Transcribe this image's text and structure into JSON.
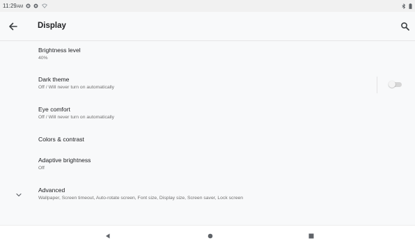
{
  "status_bar": {
    "time": "11:29",
    "ampm": "AM",
    "icons": [
      "gear-icon",
      "shield-icon",
      "wifi-icon",
      "bluetooth-icon",
      "battery-icon"
    ]
  },
  "app_bar": {
    "title": "Display",
    "back_icon": "arrow-back-icon",
    "search_icon": "search-icon"
  },
  "settings": [
    {
      "title": "Brightness level",
      "summary": "40%"
    },
    {
      "title": "Dark theme",
      "summary": "Off / Will never turn on automatically",
      "toggle_on": false
    },
    {
      "title": "Eye comfort",
      "summary": "Off / Will never turn on automatically"
    },
    {
      "title": "Colors & contrast",
      "summary": ""
    },
    {
      "title": "Adaptive brightness",
      "summary": "Off"
    },
    {
      "title": "Advanced",
      "summary": "Wallpaper, Screen timeout, Auto-rotate screen, Font size, Display size, Screen saver, Lock screen",
      "icon": "chevron-down-icon"
    }
  ],
  "nav_bar": {
    "buttons": [
      "back-triangle-icon",
      "home-circle-icon",
      "recents-square-icon"
    ]
  },
  "colors": {
    "status_bar": "#f1f1f1",
    "background": "#f8f9fa",
    "title_text": "#202124",
    "summary_text": "#6f6f6f",
    "toggle_off_track": "#d6d6d6"
  }
}
